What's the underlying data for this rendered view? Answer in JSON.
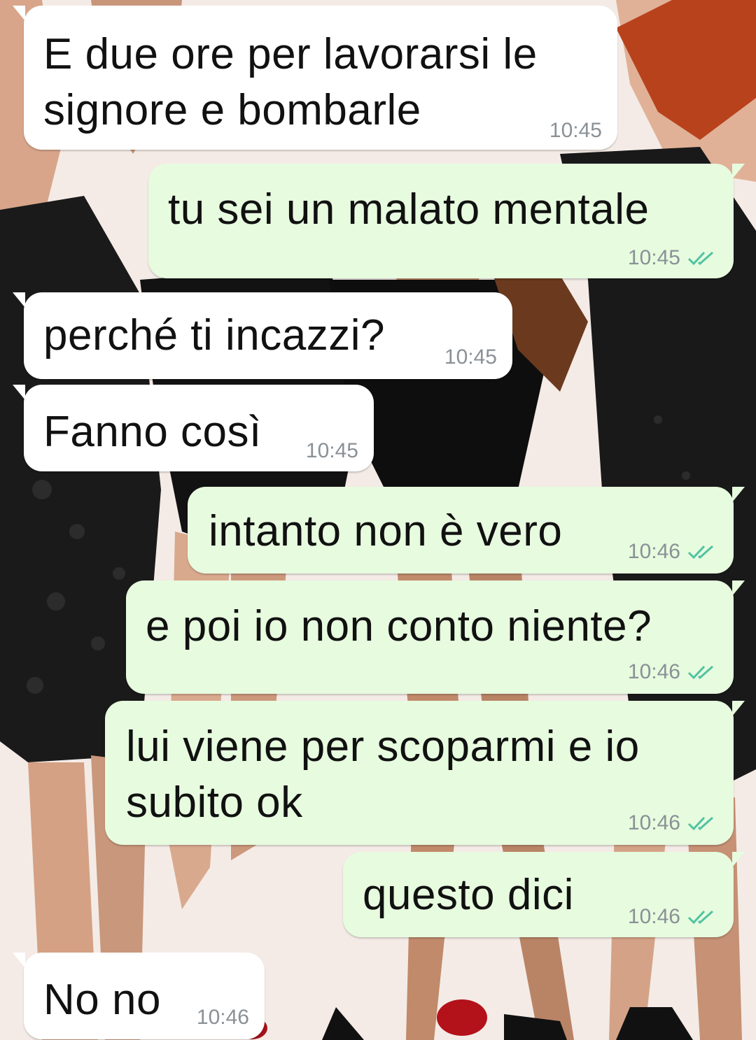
{
  "theme": {
    "incoming_bubble": "#ffffff",
    "outgoing_bubble": "#e7fbdf",
    "read_tick_color": "#4fc3a1",
    "time_color": "#8a9196"
  },
  "messages": [
    {
      "direction": "incoming",
      "text": "E due ore per lavorarsi le\nsignore e bombarle",
      "time": "10:45"
    },
    {
      "direction": "outgoing",
      "text": "tu sei un malato mentale",
      "time": "10:45",
      "status": "read-double-check"
    },
    {
      "direction": "incoming",
      "text": "perché ti incazzi?",
      "time": "10:45"
    },
    {
      "direction": "incoming",
      "text": "Fanno così",
      "time": "10:45"
    },
    {
      "direction": "outgoing",
      "text": "intanto non è vero",
      "time": "10:46",
      "status": "read-double-check"
    },
    {
      "direction": "outgoing",
      "text": "e poi io non conto niente?",
      "time": "10:46",
      "status": "read-double-check"
    },
    {
      "direction": "outgoing",
      "text": "lui viene per scoparmi e io\nsubito ok",
      "time": "10:46",
      "status": "read-double-check"
    },
    {
      "direction": "outgoing",
      "text": "questo dici",
      "time": "10:46",
      "status": "read-double-check"
    },
    {
      "direction": "incoming",
      "text": "No no",
      "time": "10:46"
    }
  ]
}
